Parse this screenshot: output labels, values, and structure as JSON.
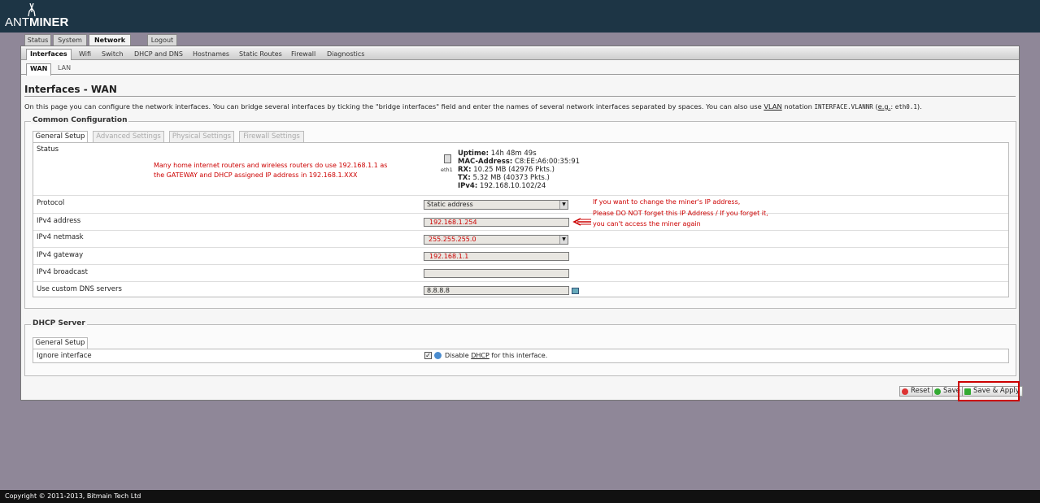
{
  "brand": {
    "logo_thin": "ANT",
    "logo_bold": "MINER"
  },
  "main_tabs": [
    {
      "label": "Status",
      "active": false
    },
    {
      "label": "System",
      "active": false
    },
    {
      "label": "Network",
      "active": true
    },
    {
      "label": "Logout",
      "active": false
    }
  ],
  "sub_nav": [
    "Interfaces",
    "Wifi",
    "Switch",
    "DHCP and DNS",
    "Hostnames",
    "Static Routes",
    "Firewall",
    "Diagnostics"
  ],
  "iface_tabs": [
    "WAN",
    "LAN"
  ],
  "page": {
    "title": "Interfaces - WAN",
    "desc_1": "On this page you can configure the network interfaces. You can bridge several interfaces by ticking the \"bridge interfaces\" field and enter the names of several network interfaces separated by spaces. You can also use ",
    "desc_vlan": "VLAN",
    "desc_2": " notation ",
    "desc_code": "INTERFACE.VLANNR",
    "desc_3": " (",
    "desc_eg": "e.g.",
    "desc_4": ": ",
    "desc_code2": "eth0.1",
    "desc_5": ")."
  },
  "common": {
    "legend": "Common Configuration",
    "tabs": [
      "General Setup",
      "Advanced Settings",
      "Physical Settings",
      "Firewall Settings"
    ],
    "status_label": "Status",
    "status": {
      "iface": "eth1",
      "uptime_label": "Uptime:",
      "uptime": "14h 48m 49s",
      "mac_label": "MAC-Address:",
      "mac": "C8:EE:A6:00:35:91",
      "rx_label": "RX:",
      "rx": "10.25 MB (42976 Pkts.)",
      "tx_label": "TX:",
      "tx": "5.32 MB (40373 Pkts.)",
      "ipv4_label": "IPv4:",
      "ipv4": "192.168.10.102/24"
    },
    "note_routers_1": "Many home internet routers and wireless routers do use 192.168.1.1 as",
    "note_routers_2": "the GATEWAY and DHCP assigned IP address in 192.168.1.XXX",
    "fields": {
      "protocol_label": "Protocol",
      "protocol_value": "Static address",
      "ipv4_address_label": "IPv4 address",
      "ipv4_address_value": "192.168.1.254",
      "netmask_label": "IPv4 netmask",
      "netmask_value": "255.255.255.0",
      "gateway_label": "IPv4 gateway",
      "gateway_value": "192.168.1.1",
      "broadcast_label": "IPv4 broadcast",
      "broadcast_value": "",
      "dns_label": "Use custom DNS servers",
      "dns_value": "8.8.8.8"
    },
    "note_ip_1": "If you want to change the miner's IP address,",
    "note_ip_2": "Please DO NOT forget this IP Address / If you forget it,",
    "note_ip_3": "you can't access the miner again"
  },
  "dhcp": {
    "legend": "DHCP Server",
    "tab": "General Setup",
    "ignore_label": "Ignore interface",
    "ignore_checked": true,
    "disable_text_1": "Disable ",
    "disable_text_dhcp": "DHCP",
    "disable_text_2": " for this interface."
  },
  "buttons": {
    "reset": "Reset",
    "save": "Save",
    "save_apply": "Save & Apply"
  },
  "footer": "Copyright © 2011-2013, Bitmain Tech Ltd",
  "colors": {
    "header": "#1d3545",
    "background": "#8f8798",
    "annotation": "#cc0000"
  }
}
